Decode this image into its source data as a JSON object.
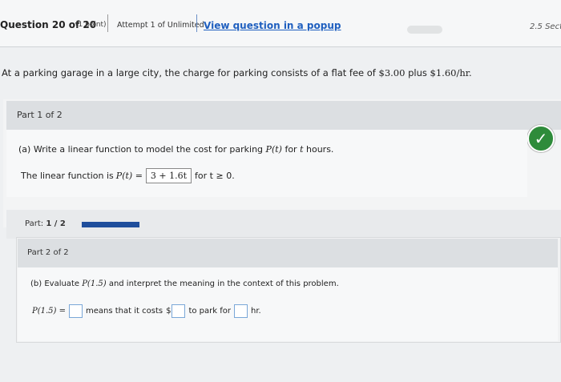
{
  "header": {
    "question_title": "Question 20 of 20",
    "points": "(1 point)",
    "attempt": "Attempt 1 of Unlimited",
    "view_popup": "View question in a popup",
    "section": "2.5 Secti"
  },
  "problem": {
    "text_before": "At a parking garage in a large city, the charge for parking consists of a flat fee of ",
    "fee": "$3.00",
    "text_mid": " plus ",
    "rate": "$1.60/hr.",
    "text_after": ""
  },
  "part1": {
    "label": "Part 1 of 2",
    "question_prefix": "(a) Write a linear function to model the cost for parking ",
    "func": "P(t)",
    "question_mid": " for ",
    "var": "t",
    "question_suffix": " hours.",
    "answer_prefix": "The linear function is ",
    "answer_func": "P(t) =",
    "answer_value": "3 + 1.6t",
    "answer_suffix": "for t ≥ 0.",
    "status": "correct"
  },
  "progress": {
    "label": "Part:",
    "value": "1 / 2",
    "fraction": 0.5
  },
  "part2": {
    "label": "Part 2 of 2",
    "question_prefix": "(b) Evaluate ",
    "func": "P(1.5)",
    "question_suffix": " and interpret the meaning in the context of this problem.",
    "row_func": "P(1.5) =",
    "row_mid1": "means that it costs",
    "row_dollar": "$",
    "row_mid2": "to park for",
    "row_unit": "hr."
  }
}
